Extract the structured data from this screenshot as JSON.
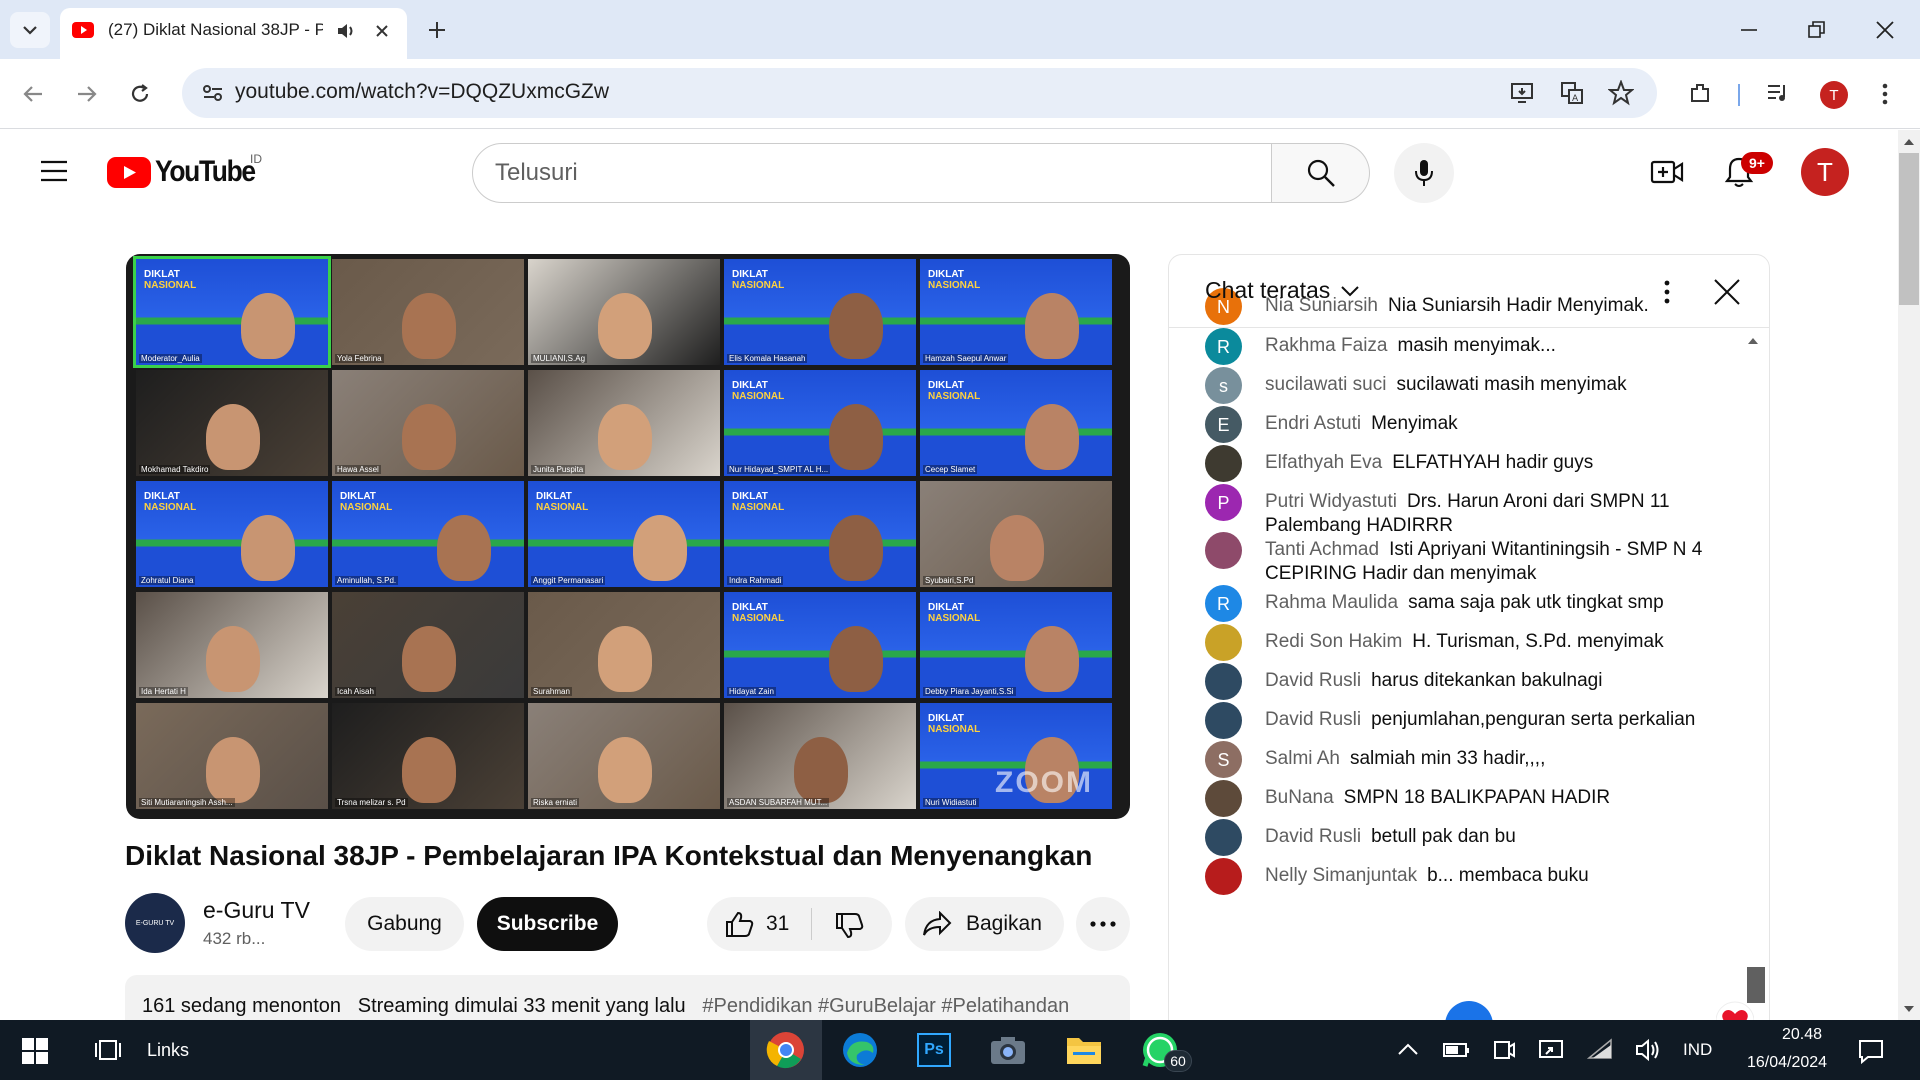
{
  "browser": {
    "tab_title": "(27) Diklat Nasional 38JP - P",
    "url": "youtube.com/watch?v=DQQZUxmcGZw",
    "profile_initial": "T"
  },
  "youtube": {
    "logo_text": "YouTube",
    "region": "ID",
    "search_placeholder": "Telusuri",
    "notif_badge": "9+",
    "profile_initial": "T"
  },
  "video": {
    "tiles": [
      {
        "name": "Moderator_Aulia",
        "banner": true
      },
      {
        "name": "Yola Febrina",
        "banner": false
      },
      {
        "name": "MULIANI,S.Ag",
        "banner": false
      },
      {
        "name": "Elis Komala Hasanah",
        "banner": true
      },
      {
        "name": "Hamzah Saepul Anwar",
        "banner": true
      },
      {
        "name": "Mokhamad Takdiro",
        "banner": false
      },
      {
        "name": "Hawa Assel",
        "banner": false
      },
      {
        "name": "Junita Puspita",
        "banner": false
      },
      {
        "name": "Nur Hidayad_SMPIT AL H...",
        "banner": true
      },
      {
        "name": "Cecep Slamet",
        "banner": true
      },
      {
        "name": "Zohratul Diana",
        "banner": true
      },
      {
        "name": "Aminullah, S.Pd.",
        "banner": true
      },
      {
        "name": "Anggit Permanasari",
        "banner": true
      },
      {
        "name": "Indra Rahmadi",
        "banner": true
      },
      {
        "name": "Syubairi,S.Pd",
        "banner": false
      },
      {
        "name": "Ida Hertati H",
        "banner": false
      },
      {
        "name": "Icah Aisah",
        "banner": false
      },
      {
        "name": "Surahman",
        "banner": false
      },
      {
        "name": "Hidayat Zain",
        "banner": true
      },
      {
        "name": "Debby Piara Jayanti,S.Si",
        "banner": true
      },
      {
        "name": "Siti Mutiaraningsih Assh...",
        "banner": false
      },
      {
        "name": "Trsna melizar s. Pd",
        "banner": false
      },
      {
        "name": "Riska erniati",
        "banner": false
      },
      {
        "name": "ASDAN SUBARFAH MUT...",
        "banner": false
      },
      {
        "name": "Nuri Widiastuti",
        "banner": true
      }
    ],
    "banner_line1": "DIKLAT",
    "banner_line2": "NASIONAL",
    "watermark": "ZOOM",
    "title": "Diklat Nasional 38JP - Pembelajaran IPA Kontekstual dan Menyenangkan"
  },
  "channel": {
    "avatar_text": "E-GURU TV",
    "name": "e-Guru TV",
    "subs": "432 rb...",
    "join_label": "Gabung",
    "subscribe_label": "Subscribe",
    "likes": "31",
    "share_label": "Bagikan"
  },
  "description": {
    "viewers": "161 sedang menonton",
    "started": "Streaming dimulai 33 menit yang lalu",
    "tags": "#Pendidikan #GuruBelajar #Pelatihandan"
  },
  "chat": {
    "header": "Chat teratas",
    "messages": [
      {
        "author": "Nia Suniarsih",
        "text": "Nia Suniarsih Hadir Menyimak.",
        "initial": "N",
        "color": "#e8710a"
      },
      {
        "author": "Rakhma Faiza",
        "text": "masih menyimak...",
        "initial": "R",
        "color": "#0b8a9c"
      },
      {
        "author": "sucilawati suci",
        "text": "sucilawati masih menyimak",
        "initial": "s",
        "color": "#78909c"
      },
      {
        "author": "Endri Astuti",
        "text": "Menyimak",
        "initial": "E",
        "color": "#455a64"
      },
      {
        "author": "Elfathyah Eva",
        "text": "ELFATHYAH hadir guys",
        "initial": "",
        "color": "#3e3a30"
      },
      {
        "author": "Putri Widyastuti",
        "text": "Drs. Harun Aroni dari SMPN 11 Palembang HADIRRR",
        "initial": "P",
        "color": "#9c27b0"
      },
      {
        "author": "Tanti Achmad",
        "text": "Isti Apriyani Witantiningsih - SMP N 4 CEPIRING Hadir dan menyimak",
        "initial": "",
        "color": "#8e4a6a"
      },
      {
        "author": "Rahma Maulida",
        "text": "sama saja pak utk tingkat smp",
        "initial": "R",
        "color": "#1e88e5"
      },
      {
        "author": "Redi Son Hakim",
        "text": "H. Turisman, S.Pd. menyimak",
        "initial": "",
        "color": "#c9a227"
      },
      {
        "author": "David Rusli",
        "text": "harus ditekankan bakulnagi",
        "initial": "",
        "color": "#2e4a62"
      },
      {
        "author": "David Rusli",
        "text": "penjumlahan,penguran serta perkalian",
        "initial": "",
        "color": "#2e4a62"
      },
      {
        "author": "Salmi Ah",
        "text": "salmiah min 33 hadir,,,,",
        "initial": "S",
        "color": "#8d6e63"
      },
      {
        "author": "BuNana",
        "text": "SMPN 18 BALIKPAPAN HADIR",
        "initial": "",
        "color": "#5d4a3a"
      },
      {
        "author": "David Rusli",
        "text": "betull pak dan bu",
        "initial": "",
        "color": "#2e4a62"
      },
      {
        "author": "Nelly Simanjuntak",
        "text": "b... membaca buku",
        "initial": "",
        "color": "#b71c1c"
      }
    ]
  },
  "taskbar": {
    "links_label": "Links",
    "whatsapp_badge": "60",
    "lang": "IND",
    "time": "20.48",
    "date": "16/04/2024"
  },
  "colors": {
    "youtube_red": "#ff0000",
    "accent_red": "#c5221f",
    "taskbar_bg": "#101a24"
  }
}
